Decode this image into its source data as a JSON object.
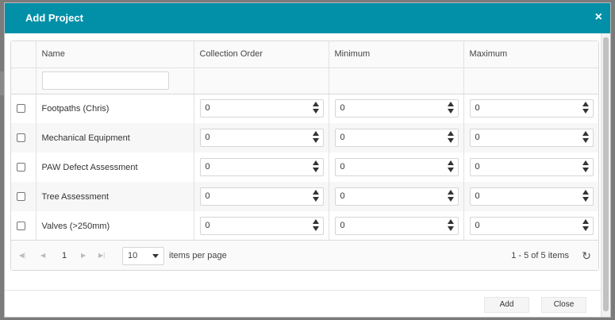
{
  "dialog": {
    "title": "Add Project",
    "close_icon": "×"
  },
  "grid": {
    "columns": [
      "Name",
      "Collection Order",
      "Minimum",
      "Maximum"
    ],
    "filter": {
      "name_value": ""
    },
    "rows": [
      {
        "name": "Footpaths (Chris)",
        "collection_order": "0",
        "minimum": "0",
        "maximum": "0"
      },
      {
        "name": "Mechanical Equipment",
        "collection_order": "0",
        "minimum": "0",
        "maximum": "0"
      },
      {
        "name": "PAW Defect Assessment",
        "collection_order": "0",
        "minimum": "0",
        "maximum": "0"
      },
      {
        "name": "Tree Assessment",
        "collection_order": "0",
        "minimum": "0",
        "maximum": "0"
      },
      {
        "name": "Valves (>250mm)",
        "collection_order": "0",
        "minimum": "0",
        "maximum": "0"
      }
    ]
  },
  "pager": {
    "current_page": "1",
    "page_size": "10",
    "items_per_page_label": "items per page",
    "info": "1 - 5 of 5 items"
  },
  "footer": {
    "add_label": "Add",
    "close_label": "Close"
  },
  "colors": {
    "titlebar": "#0290a8"
  }
}
